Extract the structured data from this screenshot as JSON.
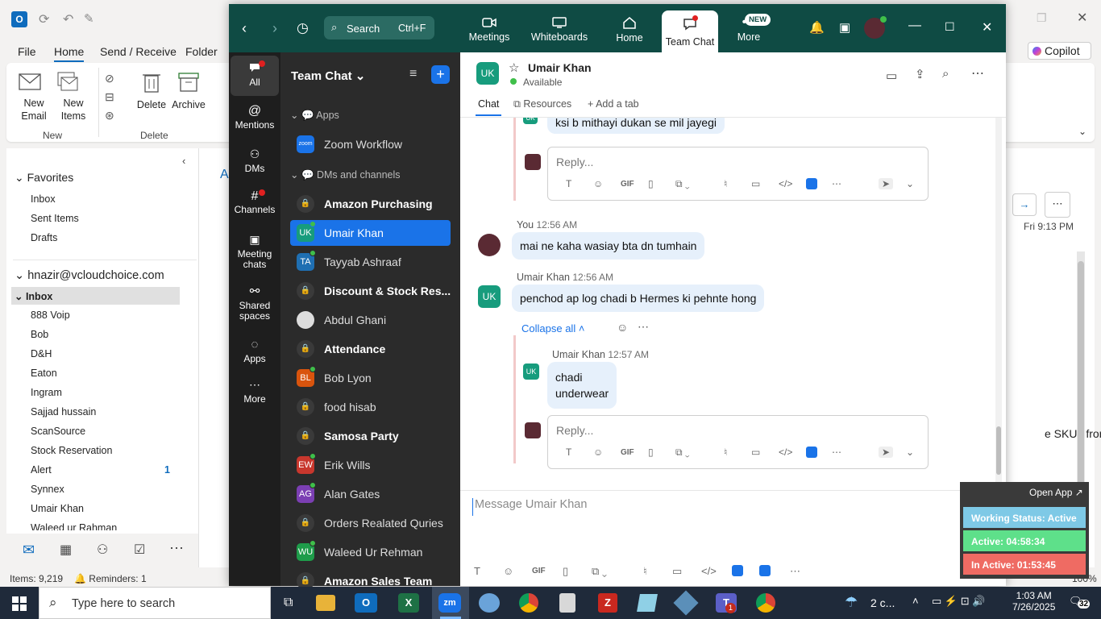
{
  "outlook": {
    "menu": [
      "File",
      "Home",
      "Send / Receive",
      "Folder"
    ],
    "copilot": "Copilot",
    "ribbon": {
      "new_email": "New\nEmail",
      "new_items": "New\nItems",
      "delete": "Delete",
      "archive": "Archive",
      "group_new": "New",
      "group_delete": "Delete"
    },
    "favorites_header": "Favorites",
    "favorites": [
      "Inbox",
      "Sent Items",
      "Drafts"
    ],
    "account": "hnazir@vcloudchoice.com",
    "inbox": "Inbox",
    "folders": [
      "888 Voip",
      "Bob",
      "D&H",
      "Eaton",
      "Ingram",
      "Sajjad hussain",
      "ScanSource",
      "Stock Reservation",
      "Alert",
      "Synnex",
      "Umair Khan",
      "Waleed ur Rahman"
    ],
    "alert_count": "1",
    "status_items": "Items: 9,219",
    "status_reminders": "Reminders: 1",
    "reading_date": "Fri 9:13 PM",
    "reading_snippet": "e SKUs from",
    "zoom_level": "100%"
  },
  "zoom": {
    "search_label": "Search",
    "search_shortcut": "Ctrl+F",
    "tabs": [
      {
        "label": "Meetings"
      },
      {
        "label": "Whiteboards"
      },
      {
        "label": "Home"
      },
      {
        "label": "Team Chat"
      },
      {
        "label": "More"
      }
    ],
    "new_badge": "NEW",
    "rail": [
      "All",
      "Mentions",
      "DMs",
      "Channels",
      "Meeting\nchats",
      "Shared\nspaces",
      "Apps",
      "More"
    ],
    "panel_title": "Team Chat",
    "section_apps": "Apps",
    "zoom_workflow": "Zoom Workflow",
    "section_dms": "DMs and channels",
    "list": [
      {
        "name": "Amazon Purchasing",
        "type": "lock",
        "bold": true
      },
      {
        "name": "Umair Khan",
        "initials": "UK",
        "color": "#179c7d",
        "selected": true
      },
      {
        "name": "Tayyab Ashraaf",
        "initials": "TA",
        "color": "#1f6fb2"
      },
      {
        "name": "Discount & Stock Res...",
        "type": "lock",
        "bold": true
      },
      {
        "name": "Abdul Ghani",
        "type": "photo"
      },
      {
        "name": "Attendance",
        "type": "lock",
        "bold": true
      },
      {
        "name": "Bob Lyon",
        "initials": "BL",
        "color": "#d9540d"
      },
      {
        "name": "food hisab",
        "type": "lock"
      },
      {
        "name": "Samosa Party",
        "type": "lock",
        "bold": true
      },
      {
        "name": "Erik Wills",
        "initials": "EW",
        "color": "#c8372d"
      },
      {
        "name": "Alan Gates",
        "initials": "AG",
        "color": "#7b3fb3"
      },
      {
        "name": "Orders Realated Quries",
        "type": "lock"
      },
      {
        "name": "Waleed Ur Rehman",
        "initials": "WU",
        "color": "#1e9c4a"
      },
      {
        "name": "Amazon Sales Team",
        "type": "lock",
        "bold": true
      }
    ],
    "chat": {
      "contact_initials": "UK",
      "contact_name": "Umair Khan",
      "contact_status": "Available",
      "tabs": [
        "Chat",
        "Resources",
        "Add a tab"
      ],
      "msg_top": "ksi b mithayi dukan se mil jayegi",
      "reply_placeholder": "Reply...",
      "you_label": "You",
      "you_time": "12:56 AM",
      "you_msg": "mai ne kaha wasiay bta dn tumhain",
      "umair_label": "Umair Khan",
      "umair_time": "12:56 AM",
      "umair_msg": "penchod ap log chadi b Hermes ki pehnte hong",
      "collapse_all": "Collapse all",
      "thread_name": "Umair Khan",
      "thread_time": "12:57 AM",
      "thread_msg_1": "chadi",
      "thread_msg_2": "underwear",
      "compose_placeholder": "Message Umair Khan",
      "gif": "GIF"
    }
  },
  "widget": {
    "open_app": "Open App",
    "working_status": "Working Status: Active",
    "active": "Active: 04:58:34",
    "inactive": "In Active: 01:53:45"
  },
  "taskbar": {
    "search_placeholder": "Type here to search",
    "weather": "2 c...",
    "time": "1:03 AM",
    "date": "7/26/2025",
    "notifications": "32",
    "teams_badge": "1"
  }
}
